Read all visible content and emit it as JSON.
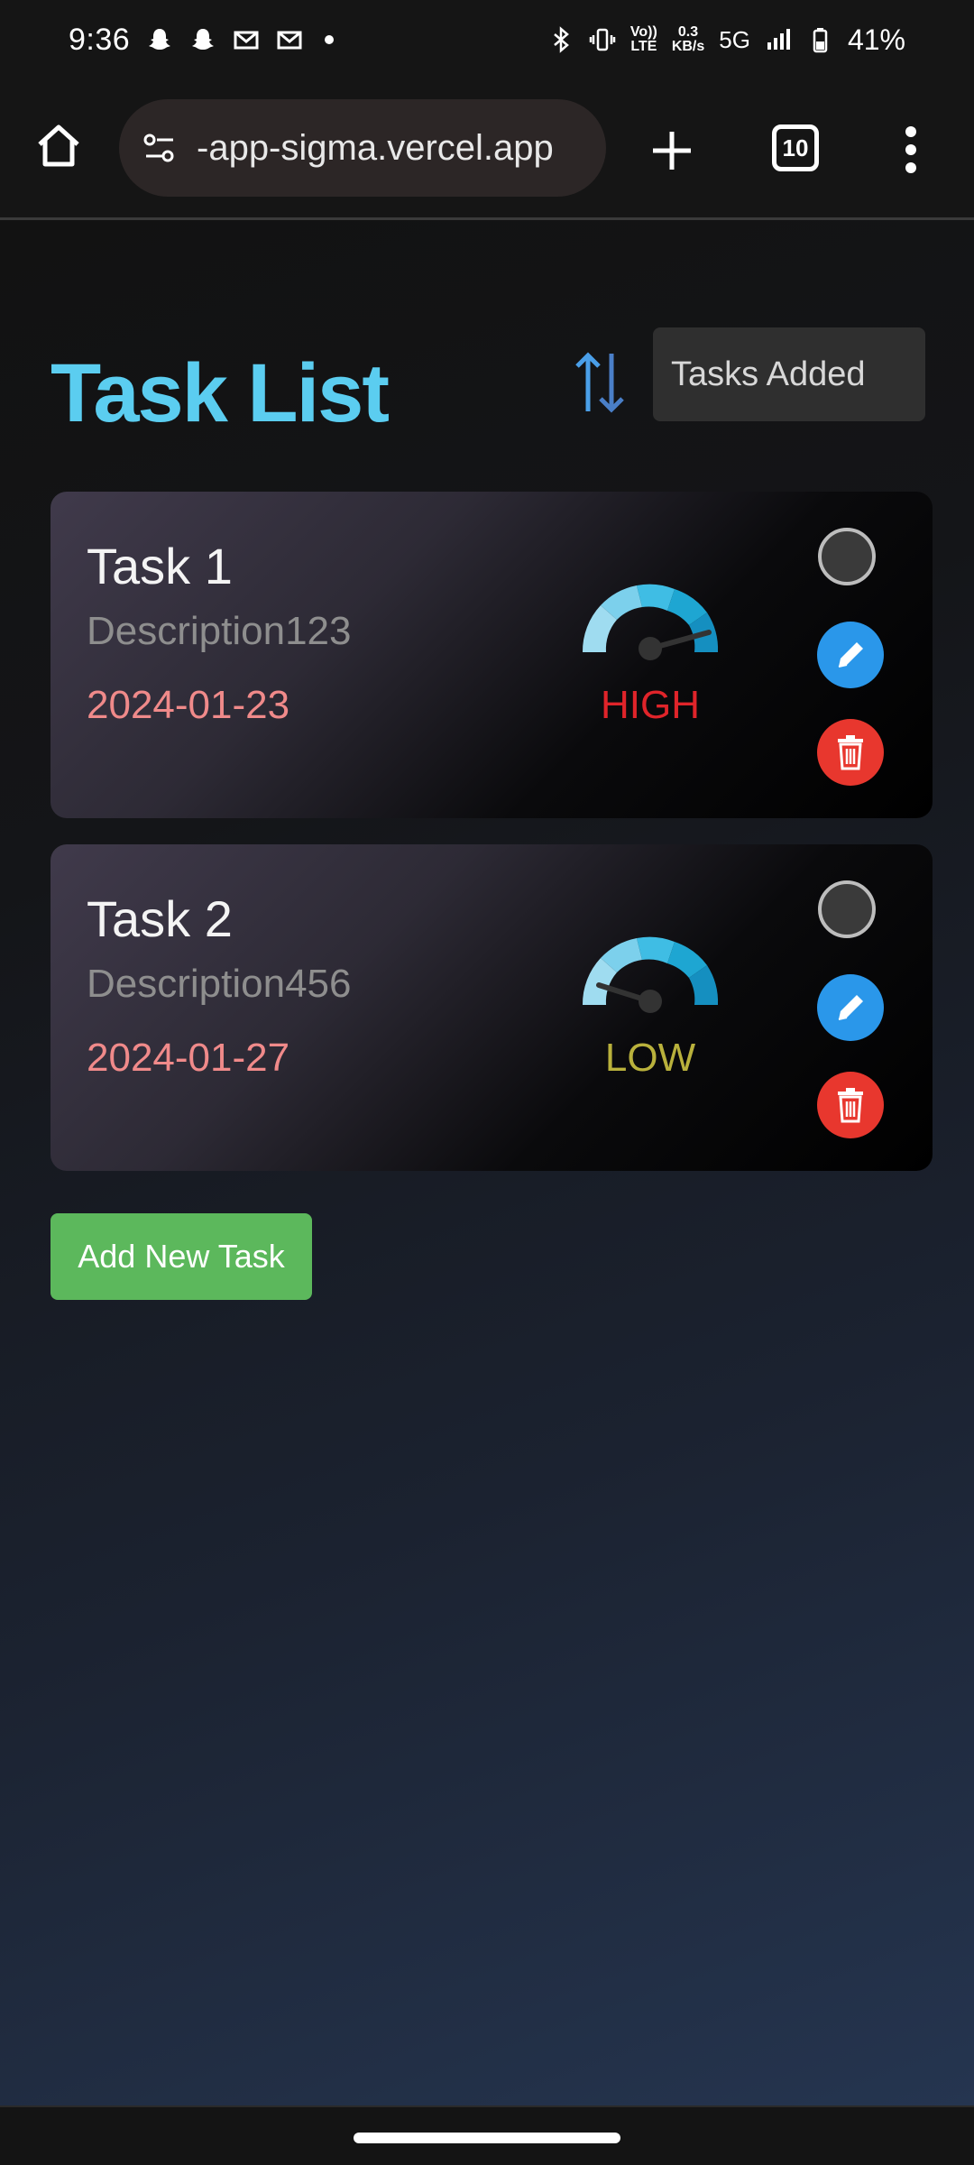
{
  "status_bar": {
    "time": "9:36",
    "network_speed_top": "0.3",
    "network_speed_unit": "KB/s",
    "volte_top": "Vo))",
    "volte_bottom": "LTE",
    "network_type": "5G",
    "battery_percent": "41%",
    "notification_icons": [
      "snapchat-icon",
      "snapchat-icon",
      "gmail-icon",
      "gmail-icon"
    ]
  },
  "browser": {
    "url": "-app-sigma.vercel.app",
    "tab_count": "10"
  },
  "page": {
    "title": "Task List",
    "sort_select_value": "Tasks Added",
    "add_button_label": "Add New Task",
    "accent_color": "#5bcdf0"
  },
  "tasks": [
    {
      "name": "Task 1",
      "description": "Description123",
      "date": "2024-01-23",
      "priority": "HIGH",
      "priority_color": "#e0242a"
    },
    {
      "name": "Task 2",
      "description": "Description456",
      "date": "2024-01-27",
      "priority": "LOW",
      "priority_color": "#b9b13c"
    }
  ]
}
